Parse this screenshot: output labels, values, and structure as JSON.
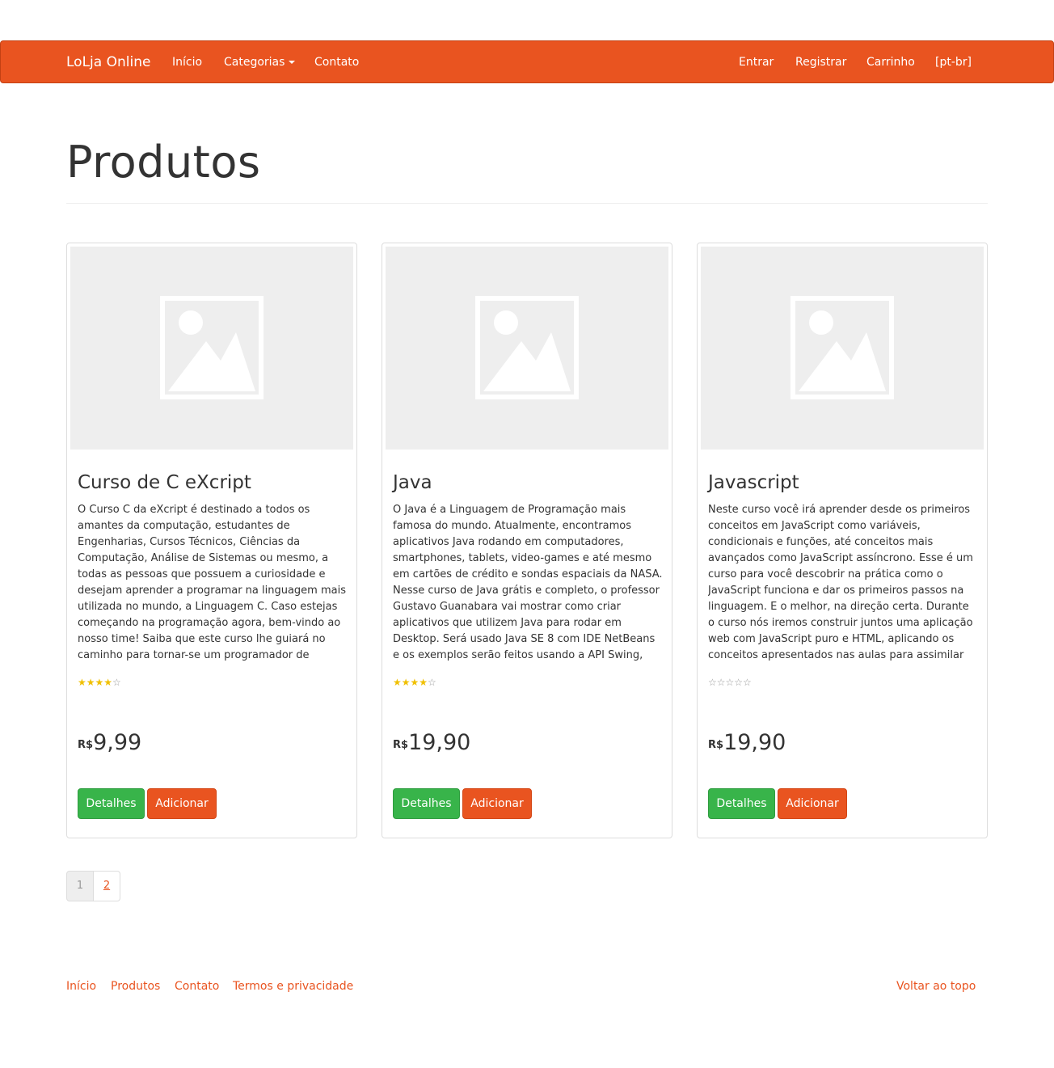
{
  "navbar": {
    "brand": "LoLja Online",
    "left_links": [
      "Início",
      "Categorias",
      "Contato"
    ],
    "right_links": [
      "Entrar",
      "Registrar",
      "Carrinho",
      "[pt-br]"
    ],
    "accent_color": "#E95420"
  },
  "page": {
    "title": "Produtos"
  },
  "products": [
    {
      "title": "Curso de C eXcript",
      "description": "O Curso C da eXcript é destinado a todos os amantes da computação, estudantes de Engenharias, Cursos Técnicos, Ciências da Computação, Análise de Sistemas ou mesmo, a todas as pessoas que possuem a curiosidade e desejam aprender a programar na linguagem mais utilizada no mundo, a Linguagem C. Caso estejas começando na programação agora, bem-vindo ao nosso time! Saiba que este curso lhe guiará no caminho para tornar-se um programador de verda…",
      "rating": 4,
      "rating_max": 5,
      "stars": "★★★★☆",
      "currency": "R$",
      "price": "9,99",
      "details_label": "Detalhes",
      "add_label": "Adicionar",
      "image_icon": "image-placeholder-icon"
    },
    {
      "title": "Java",
      "description": "O Java é a Linguagem de Programação mais famosa do mundo. Atualmente, encontramos aplicativos Java rodando em computadores, smartphones, tablets, video-games e até mesmo em cartões de crédito e sondas espaciais da NASA. Nesse curso de Java grátis e completo, o professor Gustavo Guanabara vai mostrar como criar aplicativos que utilizem Java para rodar em Desktop. Será usado Java SE 8 com IDE NetBeans e os exemplos serão feitos usando a API Swing, que cria interfaces…",
      "rating": 4,
      "rating_max": 5,
      "stars": "★★★★☆",
      "currency": "R$",
      "price": "19,90",
      "details_label": "Detalhes",
      "add_label": "Adicionar",
      "image_icon": "image-placeholder-icon"
    },
    {
      "title": "Javascript",
      "description": "Neste curso você irá aprender desde os primeiros conceitos em JavaScript como variáveis, condicionais e funções, até conceitos mais avançados como JavaScript assíncrono. Esse é um curso para você descobrir na prática como o JavaScript funciona e dar os primeiros passos na linguagem. E o melhor, na direção certa. Durante o curso nós iremos construir juntos uma aplicação web com JavaScript puro e HTML, aplicando os conceitos apresentados nas aulas para assimilar d…",
      "rating": 0,
      "rating_max": 5,
      "stars": "☆☆☆☆☆",
      "currency": "R$",
      "price": "19,90",
      "details_label": "Detalhes",
      "add_label": "Adicionar",
      "image_icon": "image-placeholder-icon"
    }
  ],
  "pagination": {
    "pages": [
      "1",
      "2"
    ],
    "current": "1"
  },
  "footer": {
    "links": [
      "Início",
      "Produtos",
      "Contato",
      "Termos e privacidade"
    ],
    "back_to_top": "Voltar ao topo"
  },
  "colors": {
    "primary": "#E95420",
    "success": "#38B44A",
    "star": "#F0C000"
  }
}
